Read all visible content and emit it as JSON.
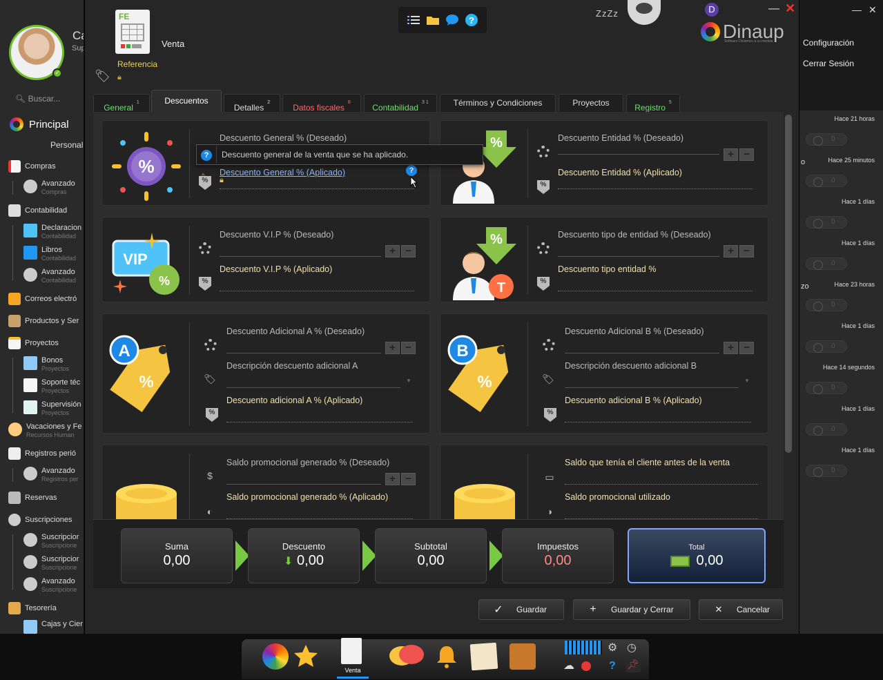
{
  "sidebar": {
    "user_name": "Ca",
    "user_sub": "Sup",
    "search_placeholder": "Buscar...",
    "principal": "Principal",
    "personal": "Personal",
    "items": [
      {
        "label": "Compras"
      },
      {
        "label": "Avanzado",
        "sub": "Compras"
      },
      {
        "label": "Contabilidad"
      },
      {
        "label": "Declaracion",
        "sub": "Contabilidad"
      },
      {
        "label": "Libros",
        "sub": "Contabilidad"
      },
      {
        "label": "Avanzado",
        "sub": "Contabilidad"
      },
      {
        "label": "Correos electró"
      },
      {
        "label": "Productos y Ser"
      },
      {
        "label": "Proyectos"
      },
      {
        "label": "Bonos",
        "sub": "Proyectos"
      },
      {
        "label": "Soporte téc",
        "sub": "Proyectos"
      },
      {
        "label": "Supervisión",
        "sub": "Proyectos"
      },
      {
        "label": "Vacaciones y Fe",
        "sub": "Recursos Human"
      },
      {
        "label": "Registros perió"
      },
      {
        "label": "Avanzado",
        "sub": "Registros per"
      },
      {
        "label": "Reservas"
      },
      {
        "label": "Suscripciones"
      },
      {
        "label": "Suscripcior",
        "sub": "Suscripcione"
      },
      {
        "label": "Suscripcior",
        "sub": "Suscripcione"
      },
      {
        "label": "Avanzado",
        "sub": "Suscripcione"
      },
      {
        "label": "Tesorería"
      },
      {
        "label": "Cajas y Cier"
      }
    ]
  },
  "right_panel": {
    "config": "Configuración",
    "logout": "Cerrar Sesión",
    "times": [
      "Hace 21 horas",
      "Hace 25 minutos",
      "Hace 1 días",
      "Hace 1 días",
      "Hace 23 horas",
      "Hace 1 días",
      "Hace 14 segundos",
      "Hace 1 días",
      "Hace 1 días"
    ],
    "fragments": [
      "o",
      "zo"
    ],
    "pill_value": "0"
  },
  "header": {
    "doc_title": "Venta",
    "reference_label": "Referencia",
    "doc_icon_text": "FE",
    "sleep_text": "ZzZz",
    "user_initial": "D",
    "brand": "Dinaup",
    "brand_sub": "Software Dinámico a su medida"
  },
  "tabs": [
    {
      "label": "General",
      "badge": "1",
      "color": "green"
    },
    {
      "label": "Descuentos",
      "badge": "",
      "color": "white",
      "active": true
    },
    {
      "label": "Detalles",
      "badge": "2",
      "color": "white"
    },
    {
      "label": "Datos fiscales",
      "badge": "8",
      "color": "red"
    },
    {
      "label": "Contabilidad",
      "badge": "3 1",
      "color": "green"
    },
    {
      "label": "Términos y Condiciones",
      "badge": "",
      "color": "white"
    },
    {
      "label": "Proyectos",
      "badge": "",
      "color": "white"
    },
    {
      "label": "Registro",
      "badge": "5",
      "color": "green"
    }
  ],
  "cards": {
    "general": {
      "desired": "Descuento General % (Deseado)",
      "applied": "Descuento General % (Aplicado)"
    },
    "entidad": {
      "desired": "Descuento Entidad % (Deseado)",
      "applied": "Descuento Entidad % (Aplicado)"
    },
    "vip": {
      "desired": "Descuento V.I.P % (Deseado)",
      "applied": "Descuento V.I.P % (Aplicado)",
      "badge": "VIP"
    },
    "tipo": {
      "desired": "Descuento tipo de entidad % (Deseado)",
      "applied": "Descuento tipo entidad %",
      "badge": "T"
    },
    "adicional_a": {
      "desired": "Descuento Adicional A % (Deseado)",
      "desc": "Descripción descuento adicional A",
      "applied": "Descuento adicional A % (Aplicado)",
      "badge": "A"
    },
    "adicional_b": {
      "desired": "Descuento Adicional B % (Deseado)",
      "desc": "Descripción descuento adicional B",
      "applied": "Descuento adicional B % (Aplicado)",
      "badge": "B"
    },
    "saldo_gen": {
      "desired": "Saldo promocional generado % (Deseado)",
      "applied": "Saldo promocional generado % (Aplicado)"
    },
    "saldo_cli": {
      "before": "Saldo que tenía el cliente antes de la venta",
      "used": "Saldo promocional utilizado"
    }
  },
  "tooltip": "Descuento general de la venta que se ha aplicado.",
  "totals": {
    "suma_label": "Suma",
    "suma_value": "0,00",
    "descuento_label": "Descuento",
    "descuento_value": "0,00",
    "subtotal_label": "Subtotal",
    "subtotal_value": "0,00",
    "impuestos_label": "Impuestos",
    "impuestos_value": "0,00",
    "total_label": "Total",
    "total_value": "0,00"
  },
  "buttons": {
    "save": "Guardar",
    "save_close": "Guardar y Cerrar",
    "cancel": "Cancelar"
  },
  "taskbar": {
    "active_label": "Venta"
  },
  "colors": {
    "accent_green": "#7ac943",
    "tab_red": "#ff6b6b",
    "tab_green": "#6ee070",
    "applied_label": "#f0e0a8",
    "total_border": "#7fa7ff"
  }
}
